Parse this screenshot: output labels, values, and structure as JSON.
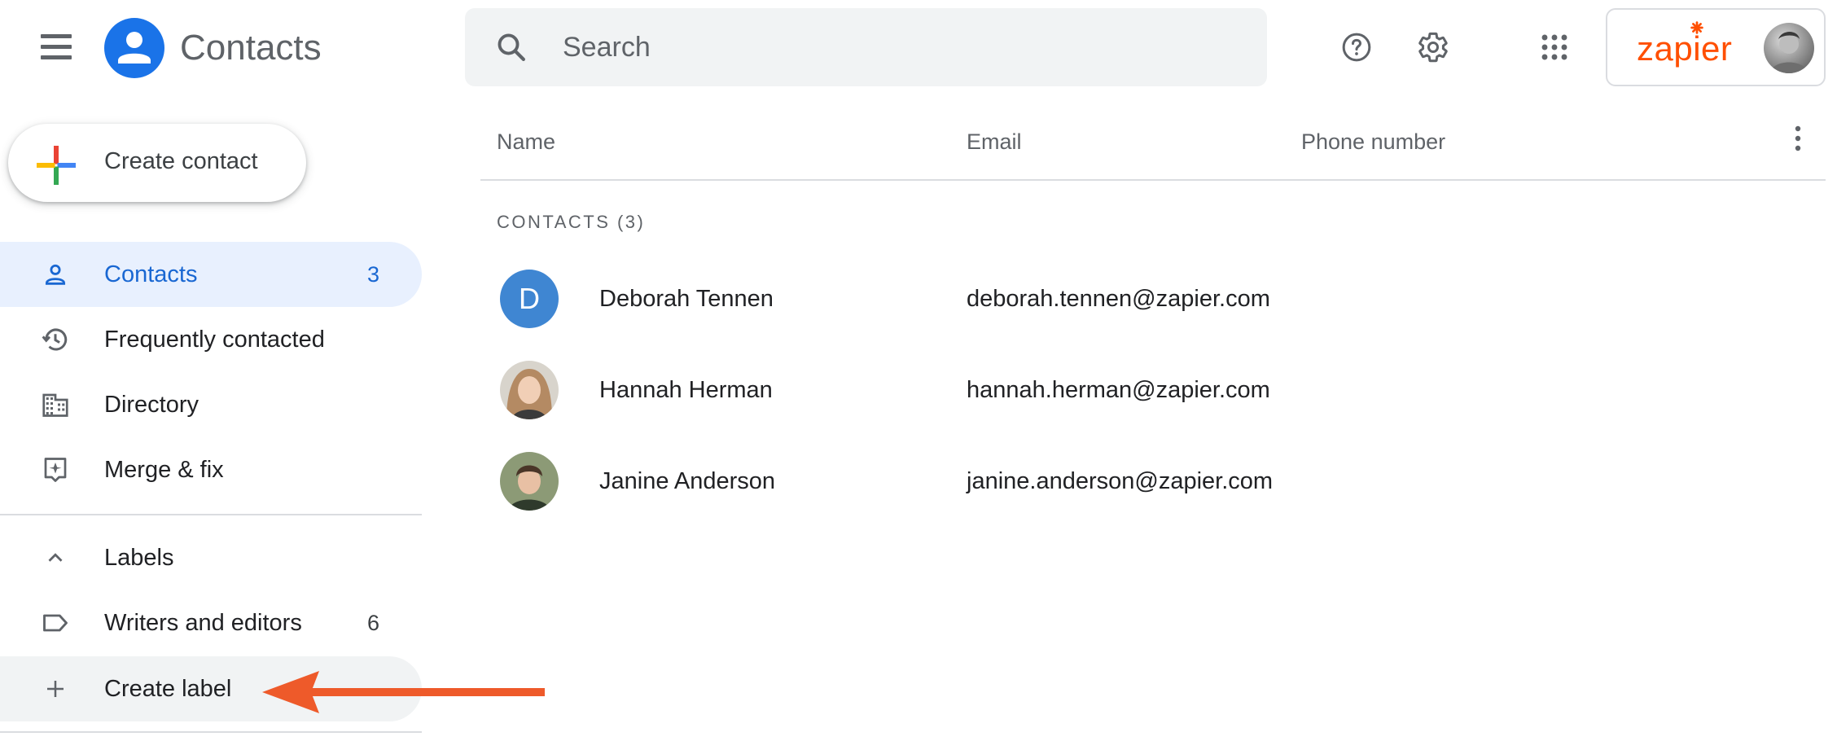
{
  "header": {
    "app_title": "Contacts",
    "search_placeholder": "Search",
    "icons": {
      "menu": "hamburger-menu-icon",
      "logo": "contacts-person-icon",
      "search": "search-icon",
      "help": "help-circle-icon",
      "settings": "gear-icon",
      "apps": "apps-grid-icon"
    },
    "account": {
      "brand": "zapier",
      "brand_color": "#ff4f00"
    }
  },
  "sidebar": {
    "create_contact_label": "Create contact",
    "items": [
      {
        "label": "Contacts",
        "count": "3",
        "icon": "person-icon",
        "active": true
      },
      {
        "label": "Frequently contacted",
        "icon": "history-icon"
      },
      {
        "label": "Directory",
        "icon": "building-icon"
      },
      {
        "label": "Merge & fix",
        "icon": "merge-fix-icon"
      }
    ],
    "labels_section": {
      "title": "Labels",
      "icon": "chevron-up-icon",
      "items": [
        {
          "label": "Writers and editors",
          "count": "6",
          "icon": "label-tag-icon"
        }
      ],
      "create_label": "Create label",
      "create_label_icon": "plus-icon"
    }
  },
  "table": {
    "columns": [
      "Name",
      "Email",
      "Phone number"
    ],
    "section_label": "CONTACTS (3)",
    "rows": [
      {
        "name": "Deborah Tennen",
        "email": "deborah.tennen@zapier.com",
        "phone": "",
        "avatar_initial": "D",
        "avatar_color": "#3f86d2"
      },
      {
        "name": "Hannah Herman",
        "email": "hannah.herman@zapier.com",
        "phone": "",
        "avatar_initial": ""
      },
      {
        "name": "Janine Anderson",
        "email": "janine.anderson@zapier.com",
        "phone": "",
        "avatar_initial": ""
      }
    ]
  },
  "colors": {
    "accent": "#1a73e8",
    "active_bg": "#e8f0fe",
    "active_text": "#1967d2",
    "annotation_arrow": "#ee5a2a"
  }
}
